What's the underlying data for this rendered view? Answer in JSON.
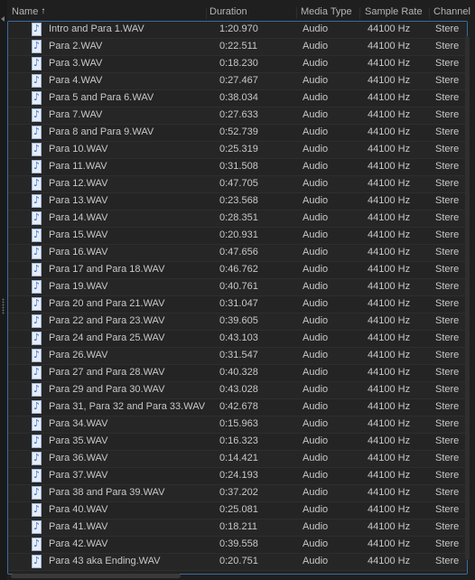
{
  "header": {
    "columns": [
      {
        "key": "name",
        "label": "Name"
      },
      {
        "key": "duration",
        "label": "Duration"
      },
      {
        "key": "media_type",
        "label": "Media Type"
      },
      {
        "key": "sample_rate",
        "label": "Sample Rate"
      },
      {
        "key": "channels",
        "label": "Channel"
      }
    ],
    "sort_indicator": "↑"
  },
  "files": [
    {
      "name": "Intro and Para 1.WAV",
      "duration": "1:20.970",
      "media_type": "Audio",
      "sample_rate": "44100 Hz",
      "channels": "Stere"
    },
    {
      "name": "Para 2.WAV",
      "duration": "0:22.511",
      "media_type": "Audio",
      "sample_rate": "44100 Hz",
      "channels": "Stere"
    },
    {
      "name": "Para 3.WAV",
      "duration": "0:18.230",
      "media_type": "Audio",
      "sample_rate": "44100 Hz",
      "channels": "Stere"
    },
    {
      "name": "Para 4.WAV",
      "duration": "0:27.467",
      "media_type": "Audio",
      "sample_rate": "44100 Hz",
      "channels": "Stere"
    },
    {
      "name": "Para 5 and Para 6.WAV",
      "duration": "0:38.034",
      "media_type": "Audio",
      "sample_rate": "44100 Hz",
      "channels": "Stere"
    },
    {
      "name": "Para 7.WAV",
      "duration": "0:27.633",
      "media_type": "Audio",
      "sample_rate": "44100 Hz",
      "channels": "Stere"
    },
    {
      "name": "Para 8 and Para 9.WAV",
      "duration": "0:52.739",
      "media_type": "Audio",
      "sample_rate": "44100 Hz",
      "channels": "Stere"
    },
    {
      "name": "Para 10.WAV",
      "duration": "0:25.319",
      "media_type": "Audio",
      "sample_rate": "44100 Hz",
      "channels": "Stere"
    },
    {
      "name": "Para 11.WAV",
      "duration": "0:31.508",
      "media_type": "Audio",
      "sample_rate": "44100 Hz",
      "channels": "Stere"
    },
    {
      "name": "Para 12.WAV",
      "duration": "0:47.705",
      "media_type": "Audio",
      "sample_rate": "44100 Hz",
      "channels": "Stere"
    },
    {
      "name": "Para 13.WAV",
      "duration": "0:23.568",
      "media_type": "Audio",
      "sample_rate": "44100 Hz",
      "channels": "Stere"
    },
    {
      "name": "Para 14.WAV",
      "duration": "0:28.351",
      "media_type": "Audio",
      "sample_rate": "44100 Hz",
      "channels": "Stere"
    },
    {
      "name": "Para 15.WAV",
      "duration": "0:20.931",
      "media_type": "Audio",
      "sample_rate": "44100 Hz",
      "channels": "Stere"
    },
    {
      "name": "Para 16.WAV",
      "duration": "0:47.656",
      "media_type": "Audio",
      "sample_rate": "44100 Hz",
      "channels": "Stere"
    },
    {
      "name": "Para 17 and Para 18.WAV",
      "duration": "0:46.762",
      "media_type": "Audio",
      "sample_rate": "44100 Hz",
      "channels": "Stere"
    },
    {
      "name": "Para 19.WAV",
      "duration": "0:40.761",
      "media_type": "Audio",
      "sample_rate": "44100 Hz",
      "channels": "Stere"
    },
    {
      "name": "Para 20 and Para 21.WAV",
      "duration": "0:31.047",
      "media_type": "Audio",
      "sample_rate": "44100 Hz",
      "channels": "Stere"
    },
    {
      "name": "Para 22 and Para 23.WAV",
      "duration": "0:39.605",
      "media_type": "Audio",
      "sample_rate": "44100 Hz",
      "channels": "Stere"
    },
    {
      "name": "Para 24 and Para 25.WAV",
      "duration": "0:43.103",
      "media_type": "Audio",
      "sample_rate": "44100 Hz",
      "channels": "Stere"
    },
    {
      "name": "Para 26.WAV",
      "duration": "0:31.547",
      "media_type": "Audio",
      "sample_rate": "44100 Hz",
      "channels": "Stere"
    },
    {
      "name": "Para 27 and Para 28.WAV",
      "duration": "0:40.328",
      "media_type": "Audio",
      "sample_rate": "44100 Hz",
      "channels": "Stere"
    },
    {
      "name": "Para 29 and Para 30.WAV",
      "duration": "0:43.028",
      "media_type": "Audio",
      "sample_rate": "44100 Hz",
      "channels": "Stere"
    },
    {
      "name": "Para 31, Para 32 and Para 33.WAV",
      "duration": "0:42.678",
      "media_type": "Audio",
      "sample_rate": "44100 Hz",
      "channels": "Stere"
    },
    {
      "name": "Para 34.WAV",
      "duration": "0:15.963",
      "media_type": "Audio",
      "sample_rate": "44100 Hz",
      "channels": "Stere"
    },
    {
      "name": "Para 35.WAV",
      "duration": "0:16.323",
      "media_type": "Audio",
      "sample_rate": "44100 Hz",
      "channels": "Stere"
    },
    {
      "name": "Para 36.WAV",
      "duration": "0:14.421",
      "media_type": "Audio",
      "sample_rate": "44100 Hz",
      "channels": "Stere"
    },
    {
      "name": "Para 37.WAV",
      "duration": "0:24.193",
      "media_type": "Audio",
      "sample_rate": "44100 Hz",
      "channels": "Stere"
    },
    {
      "name": "Para 38 and Para 39.WAV",
      "duration": "0:37.202",
      "media_type": "Audio",
      "sample_rate": "44100 Hz",
      "channels": "Stere"
    },
    {
      "name": "Para 40.WAV",
      "duration": "0:25.081",
      "media_type": "Audio",
      "sample_rate": "44100 Hz",
      "channels": "Stere"
    },
    {
      "name": "Para 41.WAV",
      "duration": "0:18.211",
      "media_type": "Audio",
      "sample_rate": "44100 Hz",
      "channels": "Stere"
    },
    {
      "name": "Para 42.WAV",
      "duration": "0:39.558",
      "media_type": "Audio",
      "sample_rate": "44100 Hz",
      "channels": "Stere"
    },
    {
      "name": "Para 43 aka Ending.WAV",
      "duration": "0:20.751",
      "media_type": "Audio",
      "sample_rate": "44100 Hz",
      "channels": "Stere"
    }
  ],
  "icons": {
    "file": "audio-file-icon",
    "splitter": "collapse-arrow-icon"
  },
  "colors": {
    "focus_border": "#3b6a9c",
    "icon_note": "#2f6fd6"
  }
}
